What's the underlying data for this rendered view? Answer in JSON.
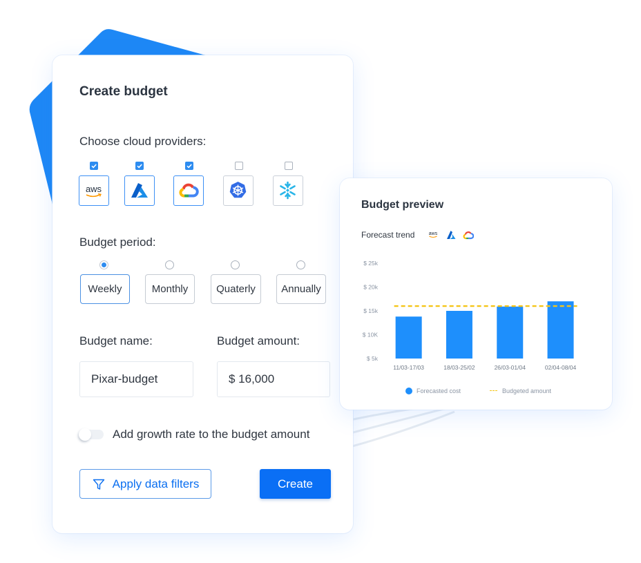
{
  "create_budget": {
    "title": "Create budget",
    "providers_label": "Choose cloud providers:",
    "providers": [
      {
        "name": "AWS",
        "icon": "aws-icon",
        "icon_text": "aws",
        "checked": true
      },
      {
        "name": "Azure",
        "icon": "azure-icon",
        "checked": true
      },
      {
        "name": "Google Cloud",
        "icon": "google-cloud-icon",
        "checked": true
      },
      {
        "name": "Kubernetes",
        "icon": "kubernetes-icon",
        "checked": false
      },
      {
        "name": "Snowflake",
        "icon": "snowflake-icon",
        "checked": false
      }
    ],
    "period_label": "Budget period:",
    "periods": [
      {
        "label": "Weekly",
        "selected": true
      },
      {
        "label": "Monthly",
        "selected": false
      },
      {
        "label": "Quaterly",
        "selected": false
      },
      {
        "label": "Annually",
        "selected": false
      }
    ],
    "name_label": "Budget name:",
    "name_value": "Pixar-budget",
    "amount_label": "Budget amount:",
    "amount_value": "$ 16,000",
    "growth_toggle": {
      "label": "Add growth rate to the budget amount",
      "on": false
    },
    "filters_button": {
      "label": "Apply data filters",
      "icon": "filter-icon"
    },
    "create_button": {
      "label": "Create"
    }
  },
  "preview": {
    "title": "Budget preview",
    "forecast_label": "Forecast trend",
    "forecast_providers": [
      {
        "name": "AWS",
        "icon": "aws-icon",
        "icon_text": "aws"
      },
      {
        "name": "Azure",
        "icon": "azure-icon"
      },
      {
        "name": "Google Cloud",
        "icon": "google-cloud-icon"
      }
    ]
  },
  "chart_data": {
    "type": "bar",
    "title": "",
    "xlabel": "",
    "ylabel": "",
    "categories": [
      "11/03-17/03",
      "18/03-25/02",
      "26/03-01/04",
      "02/04-08/04"
    ],
    "series": [
      {
        "name": "Forecasted cost",
        "type": "bar",
        "unit": "$k",
        "values": [
          13.8,
          15.0,
          15.9,
          17.0
        ]
      },
      {
        "name": "Budgeted amount",
        "type": "line",
        "style": "dashed",
        "unit": "$k",
        "values": [
          16,
          16,
          16,
          16
        ]
      }
    ],
    "budget_line": 16,
    "ylim": [
      5,
      25
    ],
    "yticks": [
      5,
      10,
      15,
      20,
      25
    ],
    "ytick_labels": [
      "$ 5k",
      "$ 10K",
      "$ 15k",
      "$ 20k",
      "$ 25k"
    ],
    "grid": false,
    "legend": {
      "position": "bottom",
      "entries": [
        "Forecasted cost",
        "Budgeted amount"
      ]
    }
  },
  "colors": {
    "accent": "#0a6ff5",
    "bar": "#1e8ffc",
    "budget_line": "#f5c518",
    "background_shape": "#1e88f5",
    "text_dark": "#2b3440"
  }
}
